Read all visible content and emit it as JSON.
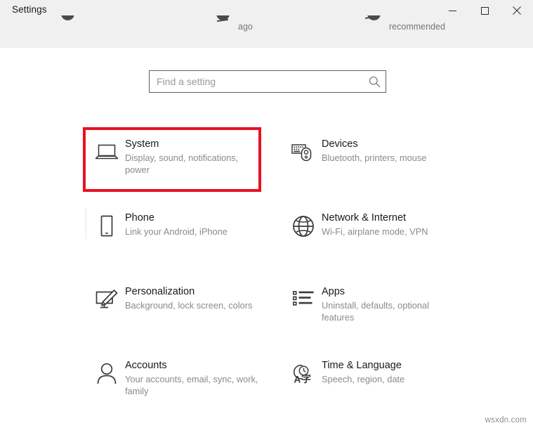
{
  "window": {
    "title": "Settings",
    "controls": [
      {
        "name": "minimize",
        "glyph": "minimize-icon"
      },
      {
        "name": "maximize",
        "glyph": "maximize-icon"
      },
      {
        "name": "close",
        "glyph": "close-icon"
      }
    ]
  },
  "clipped_row": {
    "items": [
      {
        "label": "",
        "icon": "chevron-down-icon"
      },
      {
        "label": "ago",
        "icon": "dash-icon"
      },
      {
        "label": "recommended",
        "icon": "chevron-down-icon"
      }
    ]
  },
  "search": {
    "placeholder": "Find a setting",
    "value": "",
    "icon": "search-icon"
  },
  "tiles": [
    {
      "title": "System",
      "subtitle": "Display, sound, notifications, power",
      "icon": "laptop-icon",
      "highlighted": true
    },
    {
      "title": "Devices",
      "subtitle": "Bluetooth, printers, mouse",
      "icon": "keyboard-mouse-icon",
      "highlighted": false
    },
    {
      "title": "Phone",
      "subtitle": "Link your Android, iPhone",
      "icon": "phone-icon",
      "highlighted": false
    },
    {
      "title": "Network & Internet",
      "subtitle": "Wi-Fi, airplane mode, VPN",
      "icon": "globe-icon",
      "highlighted": false
    },
    {
      "title": "Personalization",
      "subtitle": "Background, lock screen, colors",
      "icon": "monitor-brush-icon",
      "highlighted": false
    },
    {
      "title": "Apps",
      "subtitle": "Uninstall, defaults, optional features",
      "icon": "list-icon",
      "highlighted": false
    },
    {
      "title": "Accounts",
      "subtitle": "Your accounts, email, sync, work, family",
      "icon": "person-icon",
      "highlighted": false
    },
    {
      "title": "Time & Language",
      "subtitle": "Speech, region, date",
      "icon": "clock-language-icon",
      "highlighted": false
    }
  ],
  "watermark": "wsxdn.com",
  "colors": {
    "highlight": "#e81123",
    "titlebar_bg": "#f0f0f0",
    "body_bg": "#ffffff",
    "subtitle_text": "#8a8a8a"
  }
}
